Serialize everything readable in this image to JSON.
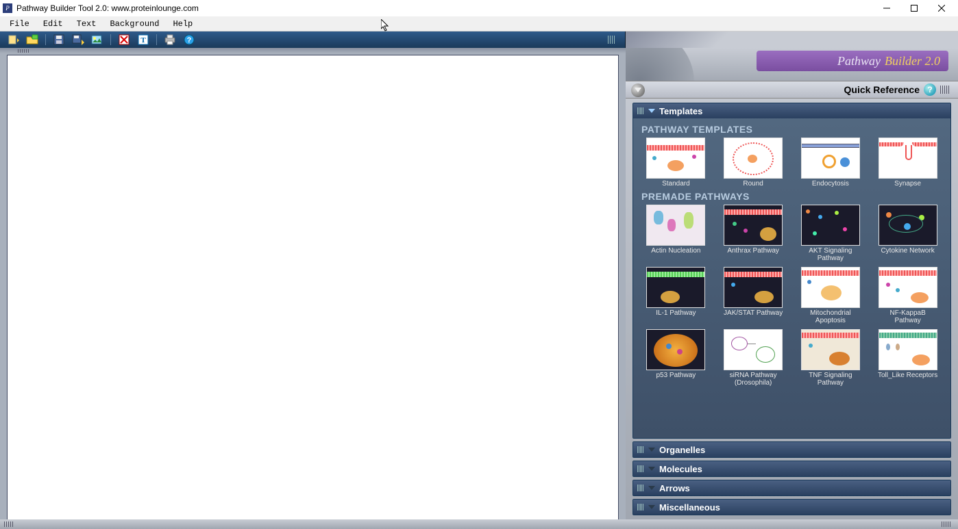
{
  "window": {
    "title": "Pathway Builder Tool 2.0: www.proteinlounge.com",
    "app_icon_letter": "P"
  },
  "menu": {
    "file": "File",
    "edit": "Edit",
    "text": "Text",
    "background": "Background",
    "help": "Help"
  },
  "brand": {
    "word1": "Pathway",
    "word2": "Builder 2.0"
  },
  "quick_reference": {
    "label": "Quick Reference",
    "help_glyph": "?"
  },
  "panels": {
    "templates": {
      "title": "Templates",
      "section_pathway_templates": "PATHWAY TEMPLATES",
      "templates": [
        {
          "label": "Standard"
        },
        {
          "label": "Round"
        },
        {
          "label": "Endocytosis"
        },
        {
          "label": "Synapse"
        }
      ],
      "section_premade": "PREMADE PATHWAYS",
      "premade": [
        {
          "label": "Actin Nucleation"
        },
        {
          "label": "Anthrax Pathway"
        },
        {
          "label": "AKT Signaling Pathway"
        },
        {
          "label": "Cytokine Network"
        },
        {
          "label": "IL-1 Pathway"
        },
        {
          "label": "JAK/STAT Pathway"
        },
        {
          "label": "Mitochondrial Apoptosis"
        },
        {
          "label": "NF-KappaB Pathway"
        },
        {
          "label": "p53 Pathway"
        },
        {
          "label": "siRNA Pathway (Drosophila)"
        },
        {
          "label": "TNF Signaling Pathway"
        },
        {
          "label": "Toll_Like Receptors"
        }
      ]
    },
    "organelles": {
      "title": "Organelles"
    },
    "molecules": {
      "title": "Molecules"
    },
    "arrows": {
      "title": "Arrows"
    },
    "miscellaneous": {
      "title": "Miscellaneous"
    }
  }
}
